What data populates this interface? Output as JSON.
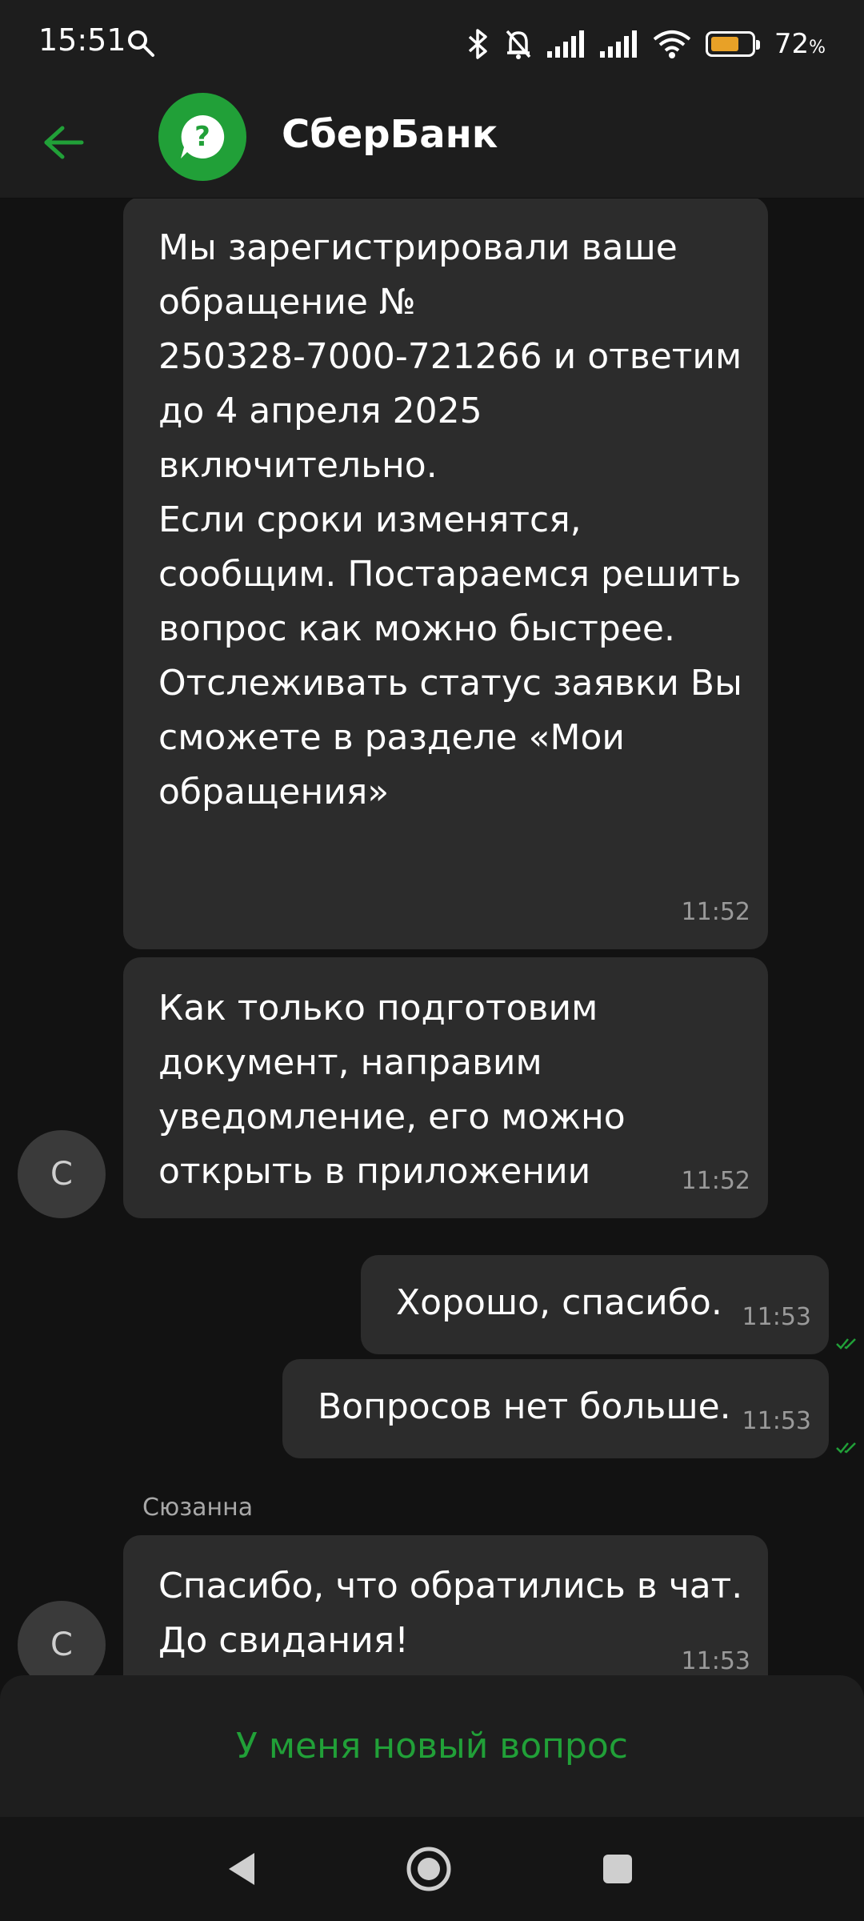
{
  "status_bar": {
    "time": "15:51",
    "battery_percent": "72",
    "battery_unit": "%",
    "battery_level": 0.72,
    "icons": [
      "search-icon",
      "bluetooth-icon",
      "bell-muted-icon",
      "signal-icon",
      "signal-icon",
      "wifi-icon",
      "battery-icon"
    ]
  },
  "header": {
    "title": "СберБанк",
    "logo_icon": "question-chat-icon",
    "back_icon": "arrow-left-icon"
  },
  "colors": {
    "brand_green": "#21a038",
    "background": "#121212",
    "bubble": "#2c2c2c",
    "battery": "#e8a127"
  },
  "messages": [
    {
      "direction": "incoming",
      "text": "Мы зарегистрировали ваше\nобращение №\n250328-7000-721266 и ответим\nдо 4 апреля 2025\nвключительно.\nЕсли сроки изменятся,\nсообщим. Постараемся решить\nвопрос как можно быстрее.\nОтслеживать статус заявки Вы\nсможете в разделе «Мои\nобращения»",
      "time": "11:52"
    },
    {
      "direction": "incoming",
      "text": "Как только подготовим\nдокумент, направим\nуведомление, его можно\nоткрыть в приложении",
      "time": "11:52"
    },
    {
      "direction": "outgoing",
      "text": "Хорошо, спасибо.",
      "time": "11:53"
    },
    {
      "direction": "outgoing",
      "text": "Вопросов нет больше.",
      "time": "11:53"
    },
    {
      "direction": "incoming",
      "sender": "Сюзанна",
      "text": "Спасибо, что обратились в чат.\nДо свидания!",
      "time": "11:53"
    }
  ],
  "avatars": [
    "С",
    "С"
  ],
  "bottom": {
    "new_question_label": "У меня новый вопрос"
  },
  "nav": {
    "back_icon": "triangle-back-icon",
    "home_icon": "circle-home-icon",
    "recent_icon": "square-recents-icon"
  }
}
